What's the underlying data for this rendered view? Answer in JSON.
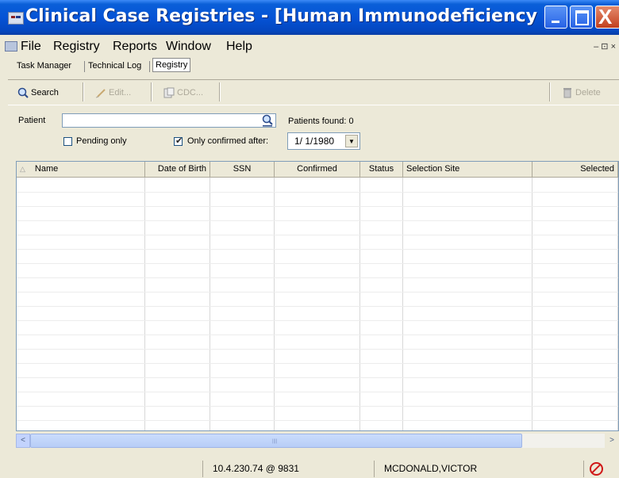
{
  "window": {
    "title": "Clinical Case Registries - [Human Immunodeficiency ...",
    "minimize_glyph": "_",
    "close_glyph": "X"
  },
  "menu": {
    "items": [
      "File",
      "Registry",
      "Reports",
      "Window",
      "Help"
    ],
    "mdi_controls": "– ⊡ ×"
  },
  "tabs": [
    {
      "label": "Task Manager",
      "active": false
    },
    {
      "label": "Technical Log",
      "active": false
    },
    {
      "label": "Registry",
      "active": true
    }
  ],
  "toolbar": {
    "search_label": "Search",
    "edit_label": "Edit...",
    "cdc_label": "CDC...",
    "delete_label": "Delete"
  },
  "search": {
    "patient_label": "Patient",
    "patient_value": "",
    "patients_found_text": "Patients found: 0",
    "pending_only_label": "Pending only",
    "pending_only_checked": false,
    "only_confirmed_label": "Only confirmed after:",
    "only_confirmed_checked": true,
    "confirmed_after_date": "1/ 1/1980"
  },
  "grid": {
    "sort_indicator": "△",
    "columns": [
      "Name",
      "Date of Birth",
      "SSN",
      "Confirmed",
      "Status",
      "Selection Site",
      "Selected"
    ],
    "rows": []
  },
  "statusbar": {
    "server": "10.4.230.74 @ 9831",
    "user": "MCDONALD,VICTOR"
  },
  "icons": {
    "search": "magnifier-icon",
    "edit": "pencil-icon",
    "cdc": "form-icon",
    "delete": "trash-icon",
    "status": "stop-icon"
  },
  "colors": {
    "titlebar": "#0553d6",
    "window_bg": "#ece9d8",
    "stop_red": "#d01818"
  }
}
